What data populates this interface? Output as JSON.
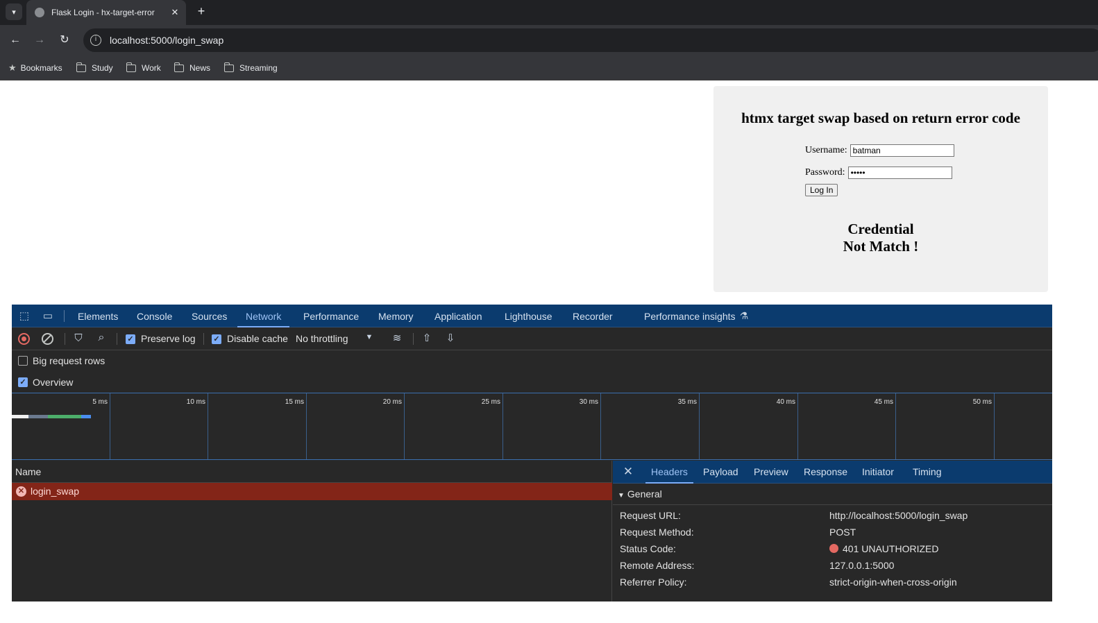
{
  "browser": {
    "tab_title": "Flask Login - hx-target-error",
    "tab_close": "✕",
    "new_tab": "+",
    "address": "localhost:5000/login_swap",
    "bookmarks": [
      "Bookmarks",
      "Study",
      "Work",
      "News",
      "Streaming"
    ]
  },
  "page": {
    "heading": "htmx target swap based on return error code",
    "username_label": "Username:",
    "username_value": "batman",
    "password_label": "Password:",
    "password_value": "•••••",
    "login_button": "Log In",
    "error_line1": "Credential",
    "error_line2": "Not Match !"
  },
  "devtools": {
    "tabs": [
      "Elements",
      "Console",
      "Sources",
      "Network",
      "Performance",
      "Memory",
      "Application",
      "Lighthouse",
      "Recorder",
      "Performance insights"
    ],
    "active_tab": "Network",
    "toolbar": {
      "preserve_log": "Preserve log",
      "disable_cache": "Disable cache",
      "throttling": "No throttling"
    },
    "options": {
      "big_request_rows": "Big request rows",
      "overview": "Overview"
    },
    "overview_ticks": [
      "5 ms",
      "10 ms",
      "15 ms",
      "20 ms",
      "25 ms",
      "30 ms",
      "35 ms",
      "40 ms",
      "45 ms",
      "50 ms"
    ],
    "name_header": "Name",
    "requests": [
      {
        "name": "login_swap",
        "status": "error"
      }
    ],
    "detail_tabs": [
      "Headers",
      "Payload",
      "Preview",
      "Response",
      "Initiator",
      "Timing"
    ],
    "active_detail_tab": "Headers",
    "general_label": "General",
    "general": [
      {
        "key": "Request URL:",
        "value": "http://localhost:5000/login_swap"
      },
      {
        "key": "Request Method:",
        "value": "POST"
      },
      {
        "key": "Status Code:",
        "value": "401 UNAUTHORIZED"
      },
      {
        "key": "Remote Address:",
        "value": "127.0.0.1:5000"
      },
      {
        "key": "Referrer Policy:",
        "value": "strict-origin-when-cross-origin"
      }
    ]
  },
  "colors": {
    "devtools_tabbar": "#0b3b6e",
    "error_row": "#832518",
    "status_error": "#e46962",
    "active_tab": "#7cacf8"
  }
}
